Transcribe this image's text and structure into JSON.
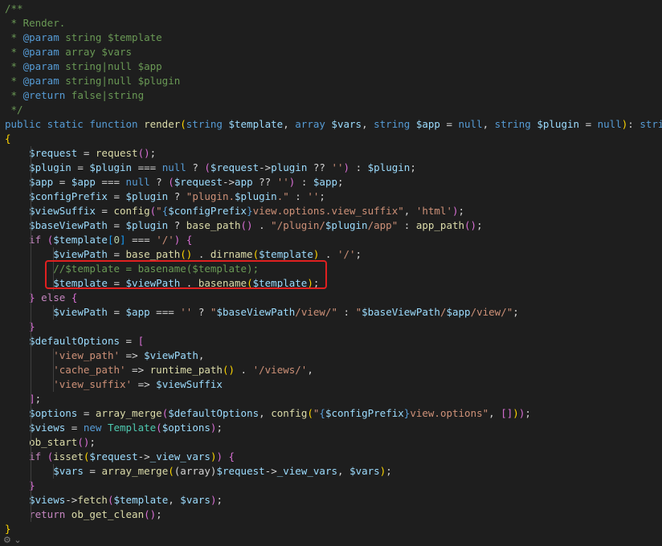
{
  "editor": {
    "language": "php",
    "highlight_box_color": "#e02020",
    "highlighted_lines": [
      19,
      20
    ]
  },
  "code_lines": [
    [
      {
        "t": "/**",
        "c": "comment"
      }
    ],
    [
      {
        "t": " * Render.",
        "c": "comment"
      }
    ],
    [
      {
        "t": " * ",
        "c": "comment"
      },
      {
        "t": "@param",
        "c": "tag"
      },
      {
        "t": " string ",
        "c": "comment"
      },
      {
        "t": "$template",
        "c": "comment"
      }
    ],
    [
      {
        "t": " * ",
        "c": "comment"
      },
      {
        "t": "@param",
        "c": "tag"
      },
      {
        "t": " array ",
        "c": "comment"
      },
      {
        "t": "$vars",
        "c": "comment"
      }
    ],
    [
      {
        "t": " * ",
        "c": "comment"
      },
      {
        "t": "@param",
        "c": "tag"
      },
      {
        "t": " string|null ",
        "c": "comment"
      },
      {
        "t": "$app",
        "c": "comment"
      }
    ],
    [
      {
        "t": " * ",
        "c": "comment"
      },
      {
        "t": "@param",
        "c": "tag"
      },
      {
        "t": " string|null ",
        "c": "comment"
      },
      {
        "t": "$plugin",
        "c": "comment"
      }
    ],
    [
      {
        "t": " * ",
        "c": "comment"
      },
      {
        "t": "@return",
        "c": "tag"
      },
      {
        "t": " false|string",
        "c": "comment"
      }
    ],
    [
      {
        "t": " */",
        "c": "comment"
      }
    ],
    [
      {
        "t": "public static function ",
        "c": "kw"
      },
      {
        "t": "render",
        "c": "fn"
      },
      {
        "t": "(",
        "c": "br1"
      },
      {
        "t": "string ",
        "c": "kw"
      },
      {
        "t": "$template",
        "c": "var"
      },
      {
        "t": ", ",
        "c": "plain"
      },
      {
        "t": "array ",
        "c": "kw"
      },
      {
        "t": "$vars",
        "c": "var"
      },
      {
        "t": ", ",
        "c": "plain"
      },
      {
        "t": "string ",
        "c": "kw"
      },
      {
        "t": "$app",
        "c": "var"
      },
      {
        "t": " = ",
        "c": "plain"
      },
      {
        "t": "null",
        "c": "kw"
      },
      {
        "t": ", ",
        "c": "plain"
      },
      {
        "t": "string ",
        "c": "kw"
      },
      {
        "t": "$plugin",
        "c": "var"
      },
      {
        "t": " = ",
        "c": "plain"
      },
      {
        "t": "null",
        "c": "kw"
      },
      {
        "t": ")",
        "c": "br1"
      },
      {
        "t": ": ",
        "c": "plain"
      },
      {
        "t": "string",
        "c": "kw"
      }
    ],
    [
      {
        "t": "{",
        "c": "br1"
      }
    ],
    [
      {
        "t": "    ",
        "c": "plain"
      },
      {
        "t": "$request",
        "c": "var"
      },
      {
        "t": " = ",
        "c": "plain"
      },
      {
        "t": "request",
        "c": "fn"
      },
      {
        "t": "()",
        "c": "br2"
      },
      {
        "t": ";",
        "c": "plain"
      }
    ],
    [
      {
        "t": "    ",
        "c": "plain"
      },
      {
        "t": "$plugin",
        "c": "var"
      },
      {
        "t": " = ",
        "c": "plain"
      },
      {
        "t": "$plugin",
        "c": "var"
      },
      {
        "t": " === ",
        "c": "plain"
      },
      {
        "t": "null",
        "c": "kw"
      },
      {
        "t": " ? ",
        "c": "plain"
      },
      {
        "t": "(",
        "c": "br2"
      },
      {
        "t": "$request",
        "c": "var"
      },
      {
        "t": "->",
        "c": "plain"
      },
      {
        "t": "plugin",
        "c": "var"
      },
      {
        "t": " ?? ",
        "c": "plain"
      },
      {
        "t": "''",
        "c": "str"
      },
      {
        "t": ")",
        "c": "br2"
      },
      {
        "t": " : ",
        "c": "plain"
      },
      {
        "t": "$plugin",
        "c": "var"
      },
      {
        "t": ";",
        "c": "plain"
      }
    ],
    [
      {
        "t": "    ",
        "c": "plain"
      },
      {
        "t": "$app",
        "c": "var"
      },
      {
        "t": " = ",
        "c": "plain"
      },
      {
        "t": "$app",
        "c": "var"
      },
      {
        "t": " === ",
        "c": "plain"
      },
      {
        "t": "null",
        "c": "kw"
      },
      {
        "t": " ? ",
        "c": "plain"
      },
      {
        "t": "(",
        "c": "br2"
      },
      {
        "t": "$request",
        "c": "var"
      },
      {
        "t": "->",
        "c": "plain"
      },
      {
        "t": "app",
        "c": "var"
      },
      {
        "t": " ?? ",
        "c": "plain"
      },
      {
        "t": "''",
        "c": "str"
      },
      {
        "t": ")",
        "c": "br2"
      },
      {
        "t": " : ",
        "c": "plain"
      },
      {
        "t": "$app",
        "c": "var"
      },
      {
        "t": ";",
        "c": "plain"
      }
    ],
    [
      {
        "t": "    ",
        "c": "plain"
      },
      {
        "t": "$configPrefix",
        "c": "var"
      },
      {
        "t": " = ",
        "c": "plain"
      },
      {
        "t": "$plugin",
        "c": "var"
      },
      {
        "t": " ? ",
        "c": "plain"
      },
      {
        "t": "\"plugin.",
        "c": "str"
      },
      {
        "t": "$plugin",
        "c": "var"
      },
      {
        "t": ".\"",
        "c": "str"
      },
      {
        "t": " : ",
        "c": "plain"
      },
      {
        "t": "''",
        "c": "str"
      },
      {
        "t": ";",
        "c": "plain"
      }
    ],
    [
      {
        "t": "    ",
        "c": "plain"
      },
      {
        "t": "$viewSuffix",
        "c": "var"
      },
      {
        "t": " = ",
        "c": "plain"
      },
      {
        "t": "config",
        "c": "fn"
      },
      {
        "t": "(",
        "c": "br2"
      },
      {
        "t": "\"",
        "c": "str"
      },
      {
        "t": "{",
        "c": "kw"
      },
      {
        "t": "$configPrefix",
        "c": "var"
      },
      {
        "t": "}",
        "c": "kw"
      },
      {
        "t": "view.options.view_suffix\"",
        "c": "str"
      },
      {
        "t": ", ",
        "c": "plain"
      },
      {
        "t": "'html'",
        "c": "str"
      },
      {
        "t": ")",
        "c": "br2"
      },
      {
        "t": ";",
        "c": "plain"
      }
    ],
    [
      {
        "t": "    ",
        "c": "plain"
      },
      {
        "t": "$baseViewPath",
        "c": "var"
      },
      {
        "t": " = ",
        "c": "plain"
      },
      {
        "t": "$plugin",
        "c": "var"
      },
      {
        "t": " ? ",
        "c": "plain"
      },
      {
        "t": "base_path",
        "c": "fn"
      },
      {
        "t": "()",
        "c": "br2"
      },
      {
        "t": " . ",
        "c": "plain"
      },
      {
        "t": "\"/plugin/",
        "c": "str"
      },
      {
        "t": "$plugin",
        "c": "var"
      },
      {
        "t": "/app\"",
        "c": "str"
      },
      {
        "t": " : ",
        "c": "plain"
      },
      {
        "t": "app_path",
        "c": "fn"
      },
      {
        "t": "()",
        "c": "br2"
      },
      {
        "t": ";",
        "c": "plain"
      }
    ],
    [
      {
        "t": "    ",
        "c": "plain"
      },
      {
        "t": "if ",
        "c": "ctrl"
      },
      {
        "t": "(",
        "c": "br2"
      },
      {
        "t": "$template",
        "c": "var"
      },
      {
        "t": "[",
        "c": "br3"
      },
      {
        "t": "0",
        "c": "num"
      },
      {
        "t": "]",
        "c": "br3"
      },
      {
        "t": " === ",
        "c": "plain"
      },
      {
        "t": "'/'",
        "c": "str"
      },
      {
        "t": ")",
        "c": "br2"
      },
      {
        "t": " ",
        "c": "plain"
      },
      {
        "t": "{",
        "c": "br2"
      }
    ],
    [
      {
        "t": "        ",
        "c": "plain"
      },
      {
        "t": "$viewPath",
        "c": "var"
      },
      {
        "t": " = ",
        "c": "plain"
      },
      {
        "t": "base_path",
        "c": "fn"
      },
      {
        "t": "()",
        "c": "br1"
      },
      {
        "t": " . ",
        "c": "plain"
      },
      {
        "t": "dirname",
        "c": "fn"
      },
      {
        "t": "(",
        "c": "br1"
      },
      {
        "t": "$template",
        "c": "var"
      },
      {
        "t": ")",
        "c": "br1"
      },
      {
        "t": " . ",
        "c": "plain"
      },
      {
        "t": "'/'",
        "c": "str"
      },
      {
        "t": ";",
        "c": "plain"
      }
    ],
    [
      {
        "t": "        ",
        "c": "plain"
      },
      {
        "t": "//$template = basename($template);",
        "c": "comment"
      }
    ],
    [
      {
        "t": "        ",
        "c": "plain"
      },
      {
        "t": "$template",
        "c": "var"
      },
      {
        "t": " = ",
        "c": "plain"
      },
      {
        "t": "$viewPath",
        "c": "var"
      },
      {
        "t": " . ",
        "c": "plain"
      },
      {
        "t": "basename",
        "c": "fn"
      },
      {
        "t": "(",
        "c": "br1"
      },
      {
        "t": "$template",
        "c": "var"
      },
      {
        "t": ")",
        "c": "br1"
      },
      {
        "t": ";",
        "c": "plain"
      }
    ],
    [
      {
        "t": "    ",
        "c": "plain"
      },
      {
        "t": "}",
        "c": "br2"
      },
      {
        "t": " ",
        "c": "plain"
      },
      {
        "t": "else",
        "c": "ctrl"
      },
      {
        "t": " ",
        "c": "plain"
      },
      {
        "t": "{",
        "c": "br2"
      }
    ],
    [
      {
        "t": "        ",
        "c": "plain"
      },
      {
        "t": "$viewPath",
        "c": "var"
      },
      {
        "t": " = ",
        "c": "plain"
      },
      {
        "t": "$app",
        "c": "var"
      },
      {
        "t": " === ",
        "c": "plain"
      },
      {
        "t": "''",
        "c": "str"
      },
      {
        "t": " ? ",
        "c": "plain"
      },
      {
        "t": "\"",
        "c": "str"
      },
      {
        "t": "$baseViewPath",
        "c": "var"
      },
      {
        "t": "/view/\"",
        "c": "str"
      },
      {
        "t": " : ",
        "c": "plain"
      },
      {
        "t": "\"",
        "c": "str"
      },
      {
        "t": "$baseViewPath",
        "c": "var"
      },
      {
        "t": "/",
        "c": "str"
      },
      {
        "t": "$app",
        "c": "var"
      },
      {
        "t": "/view/\"",
        "c": "str"
      },
      {
        "t": ";",
        "c": "plain"
      }
    ],
    [
      {
        "t": "    ",
        "c": "plain"
      },
      {
        "t": "}",
        "c": "br2"
      }
    ],
    [
      {
        "t": "    ",
        "c": "plain"
      },
      {
        "t": "$defaultOptions",
        "c": "var"
      },
      {
        "t": " = ",
        "c": "plain"
      },
      {
        "t": "[",
        "c": "br2"
      }
    ],
    [
      {
        "t": "        ",
        "c": "plain"
      },
      {
        "t": "'view_path'",
        "c": "str"
      },
      {
        "t": " => ",
        "c": "plain"
      },
      {
        "t": "$viewPath",
        "c": "var"
      },
      {
        "t": ",",
        "c": "plain"
      }
    ],
    [
      {
        "t": "        ",
        "c": "plain"
      },
      {
        "t": "'cache_path'",
        "c": "str"
      },
      {
        "t": " => ",
        "c": "plain"
      },
      {
        "t": "runtime_path",
        "c": "fn"
      },
      {
        "t": "()",
        "c": "br1"
      },
      {
        "t": " . ",
        "c": "plain"
      },
      {
        "t": "'/views/'",
        "c": "str"
      },
      {
        "t": ",",
        "c": "plain"
      }
    ],
    [
      {
        "t": "        ",
        "c": "plain"
      },
      {
        "t": "'view_suffix'",
        "c": "str"
      },
      {
        "t": " => ",
        "c": "plain"
      },
      {
        "t": "$viewSuffix",
        "c": "var"
      }
    ],
    [
      {
        "t": "    ",
        "c": "plain"
      },
      {
        "t": "]",
        "c": "br2"
      },
      {
        "t": ";",
        "c": "plain"
      }
    ],
    [
      {
        "t": "    ",
        "c": "plain"
      },
      {
        "t": "$options",
        "c": "var"
      },
      {
        "t": " = ",
        "c": "plain"
      },
      {
        "t": "array_merge",
        "c": "fn"
      },
      {
        "t": "(",
        "c": "br2"
      },
      {
        "t": "$defaultOptions",
        "c": "var"
      },
      {
        "t": ", ",
        "c": "plain"
      },
      {
        "t": "config",
        "c": "fn"
      },
      {
        "t": "(",
        "c": "br1"
      },
      {
        "t": "\"",
        "c": "str"
      },
      {
        "t": "{",
        "c": "kw"
      },
      {
        "t": "$configPrefix",
        "c": "var"
      },
      {
        "t": "}",
        "c": "kw"
      },
      {
        "t": "view.options\"",
        "c": "str"
      },
      {
        "t": ", ",
        "c": "plain"
      },
      {
        "t": "[]",
        "c": "br2"
      },
      {
        "t": ")",
        "c": "br1"
      },
      {
        "t": ")",
        "c": "br2"
      },
      {
        "t": ";",
        "c": "plain"
      }
    ],
    [
      {
        "t": "    ",
        "c": "plain"
      },
      {
        "t": "$views",
        "c": "var"
      },
      {
        "t": " = ",
        "c": "plain"
      },
      {
        "t": "new ",
        "c": "kw"
      },
      {
        "t": "Template",
        "c": "cls"
      },
      {
        "t": "(",
        "c": "br2"
      },
      {
        "t": "$options",
        "c": "var"
      },
      {
        "t": ")",
        "c": "br2"
      },
      {
        "t": ";",
        "c": "plain"
      }
    ],
    [
      {
        "t": "    ",
        "c": "plain"
      },
      {
        "t": "ob_start",
        "c": "fn"
      },
      {
        "t": "()",
        "c": "br2"
      },
      {
        "t": ";",
        "c": "plain"
      }
    ],
    [
      {
        "t": "    ",
        "c": "plain"
      },
      {
        "t": "if ",
        "c": "ctrl"
      },
      {
        "t": "(",
        "c": "br2"
      },
      {
        "t": "isset",
        "c": "fn"
      },
      {
        "t": "(",
        "c": "br1"
      },
      {
        "t": "$request",
        "c": "var"
      },
      {
        "t": "->",
        "c": "plain"
      },
      {
        "t": "_view_vars",
        "c": "var"
      },
      {
        "t": ")",
        "c": "br1"
      },
      {
        "t": ")",
        "c": "br2"
      },
      {
        "t": " ",
        "c": "plain"
      },
      {
        "t": "{",
        "c": "br2"
      }
    ],
    [
      {
        "t": "        ",
        "c": "plain"
      },
      {
        "t": "$vars",
        "c": "var"
      },
      {
        "t": " = ",
        "c": "plain"
      },
      {
        "t": "array_merge",
        "c": "fn"
      },
      {
        "t": "(",
        "c": "br1"
      },
      {
        "t": "(array)",
        "c": "plain"
      },
      {
        "t": "$request",
        "c": "var"
      },
      {
        "t": "->",
        "c": "plain"
      },
      {
        "t": "_view_vars",
        "c": "var"
      },
      {
        "t": ", ",
        "c": "plain"
      },
      {
        "t": "$vars",
        "c": "var"
      },
      {
        "t": ")",
        "c": "br1"
      },
      {
        "t": ";",
        "c": "plain"
      }
    ],
    [
      {
        "t": "    ",
        "c": "plain"
      },
      {
        "t": "}",
        "c": "br2"
      }
    ],
    [
      {
        "t": "    ",
        "c": "plain"
      },
      {
        "t": "$views",
        "c": "var"
      },
      {
        "t": "->",
        "c": "plain"
      },
      {
        "t": "fetch",
        "c": "fn"
      },
      {
        "t": "(",
        "c": "br2"
      },
      {
        "t": "$template",
        "c": "var"
      },
      {
        "t": ", ",
        "c": "plain"
      },
      {
        "t": "$vars",
        "c": "var"
      },
      {
        "t": ")",
        "c": "br2"
      },
      {
        "t": ";",
        "c": "plain"
      }
    ],
    [
      {
        "t": "    ",
        "c": "plain"
      },
      {
        "t": "return ",
        "c": "ctrl"
      },
      {
        "t": "ob_get_clean",
        "c": "fn"
      },
      {
        "t": "()",
        "c": "br2"
      },
      {
        "t": ";",
        "c": "plain"
      }
    ],
    [
      {
        "t": "}",
        "c": "br1"
      }
    ]
  ]
}
